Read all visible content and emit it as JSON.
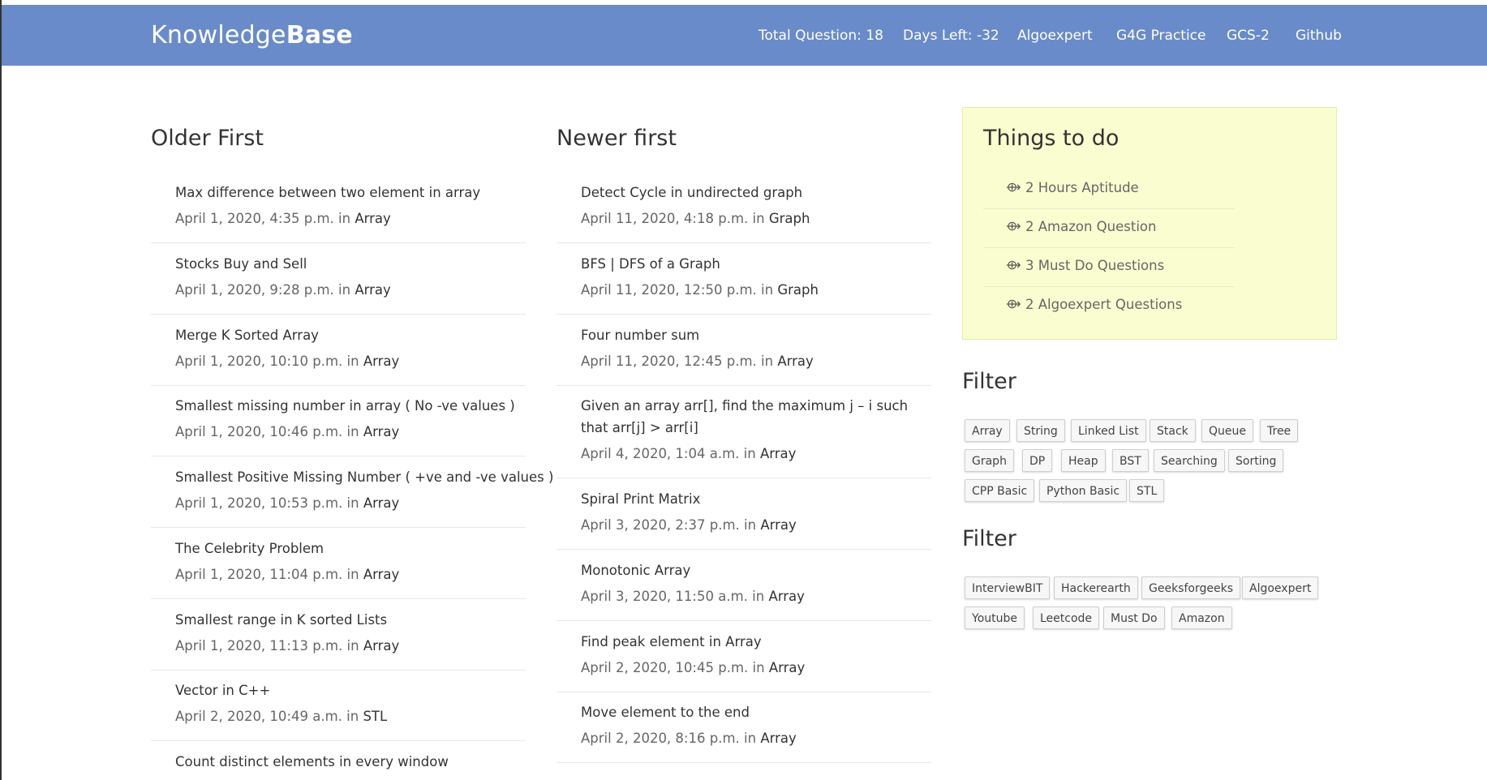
{
  "nav": {
    "brand_light": "Knowledge",
    "brand_bold": "Base",
    "links": [
      "Total Question: 18",
      "Days Left: -32",
      "Algoexpert",
      "G4G Practice",
      "GCS-2",
      "Github"
    ]
  },
  "older": {
    "title": "Older First",
    "posts": [
      {
        "title": "Max difference between two element in array",
        "date": "April 1, 2020, 4:35 p.m.",
        "in": "in",
        "category": "Array"
      },
      {
        "title": "Stocks Buy and Sell",
        "date": "April 1, 2020, 9:28 p.m.",
        "in": "in",
        "category": "Array"
      },
      {
        "title": "Merge K Sorted Array",
        "date": "April 1, 2020, 10:10 p.m.",
        "in": "in",
        "category": "Array"
      },
      {
        "title": "Smallest missing number in array ( No -ve values )",
        "date": "April 1, 2020, 10:46 p.m.",
        "in": "in",
        "category": "Array"
      },
      {
        "title": "Smallest Positive Missing Number ( +ve and -ve values )",
        "date": "April 1, 2020, 10:53 p.m.",
        "in": "in",
        "category": "Array"
      },
      {
        "title": "The Celebrity Problem",
        "date": "April 1, 2020, 11:04 p.m.",
        "in": "in",
        "category": "Array"
      },
      {
        "title": "Smallest range in K sorted Lists",
        "date": "April 1, 2020, 11:13 p.m.",
        "in": "in",
        "category": "Array"
      },
      {
        "title": "Vector in C++",
        "date": "April 2, 2020, 10:49 a.m.",
        "in": "in",
        "category": "STL"
      },
      {
        "title": "Count distinct elements in every window",
        "date": "",
        "in": "",
        "category": ""
      }
    ]
  },
  "newer": {
    "title": "Newer first",
    "posts": [
      {
        "title": "Detect Cycle in undirected graph",
        "date": "April 11, 2020, 4:18 p.m.",
        "in": "in",
        "category": "Graph"
      },
      {
        "title": "BFS | DFS of a Graph",
        "date": "April 11, 2020, 12:50 p.m.",
        "in": "in",
        "category": "Graph"
      },
      {
        "title": "Four number sum",
        "date": "April 11, 2020, 12:45 p.m.",
        "in": "in",
        "category": "Array"
      },
      {
        "title": "Given an array arr[], find the maximum j – i such that arr[j] > arr[i]",
        "date": "April 4, 2020, 1:04 a.m.",
        "in": "in",
        "category": "Array"
      },
      {
        "title": "Spiral Print Matrix",
        "date": "April 3, 2020, 2:37 p.m.",
        "in": "in",
        "category": "Array"
      },
      {
        "title": "Monotonic Array",
        "date": "April 3, 2020, 11:50 a.m.",
        "in": "in",
        "category": "Array"
      },
      {
        "title": "Find peak element in Array",
        "date": "April 2, 2020, 10:45 p.m.",
        "in": "in",
        "category": "Array"
      },
      {
        "title": "Move element to the end",
        "date": "April 2, 2020, 8:16 p.m.",
        "in": "in",
        "category": "Array"
      }
    ]
  },
  "todo": {
    "title": "Things to do",
    "items": [
      "2 Hours Aptitude",
      "2 Amazon Question",
      "3 Must Do Questions",
      "2 Algoexpert Questions"
    ]
  },
  "filter1": {
    "title": "Filter",
    "tags": [
      "Array",
      "String",
      "Linked List",
      "Stack",
      "Queue",
      "Tree",
      "Graph",
      "DP",
      "Heap",
      "BST",
      "Searching",
      "Sorting",
      "CPP Basic",
      "Python Basic",
      "STL"
    ]
  },
  "filter2": {
    "title": "Filter",
    "tags": [
      "InterviewBIT",
      "Hackerearth",
      "Geeksforgeeks",
      "Algoexpert",
      "Youtube",
      "Leetcode",
      "Must Do",
      "Amazon"
    ]
  },
  "colors": {
    "navbar": "#6a8bca",
    "todo_bg": "#fafdd0"
  }
}
